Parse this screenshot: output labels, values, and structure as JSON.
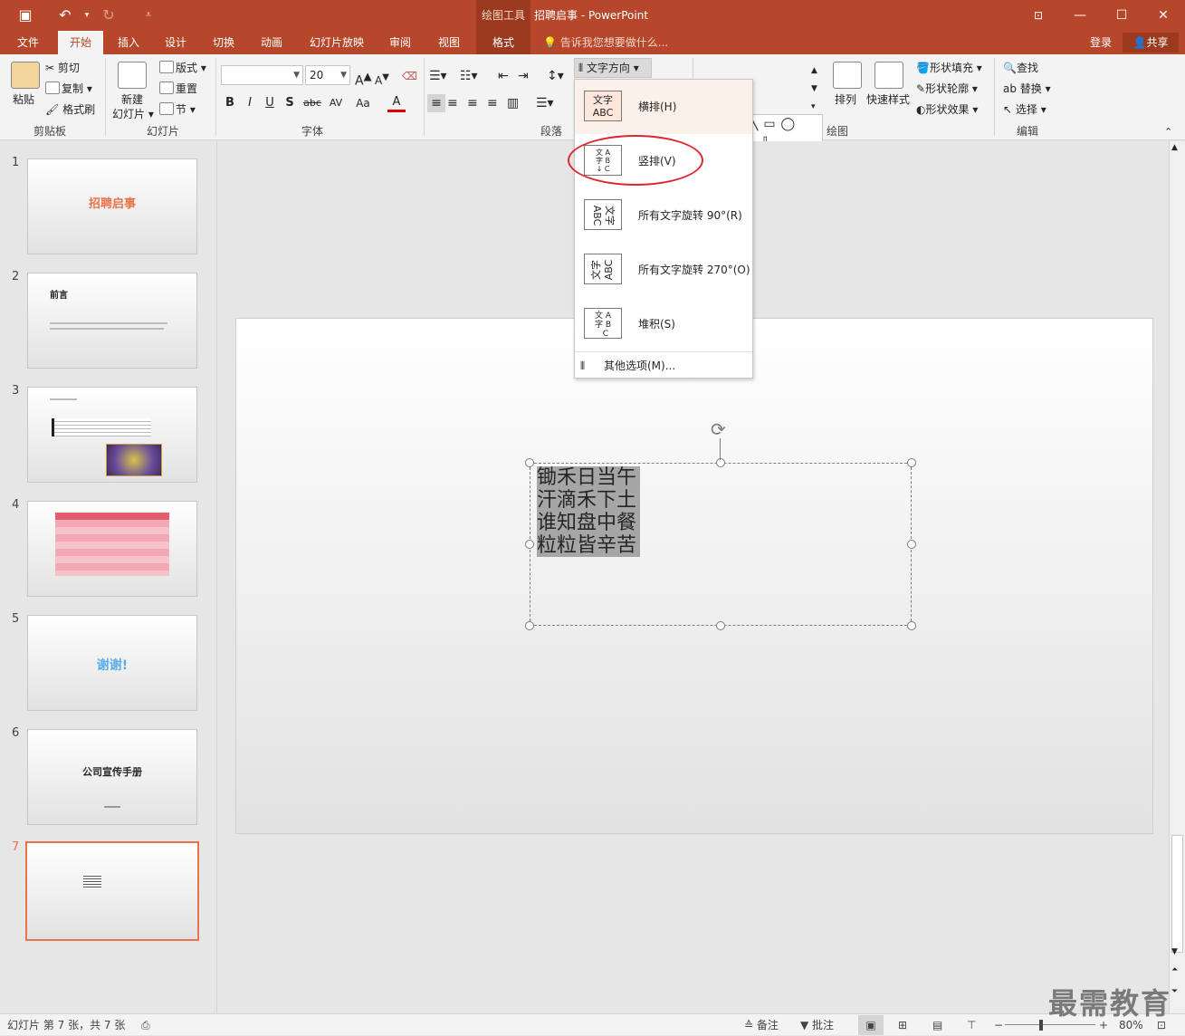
{
  "titlebar": {
    "context_group": "绘图工具",
    "title": "招聘启事 - PowerPoint",
    "icons": [
      "save-icon",
      "undo-icon",
      "redo-icon",
      "customize-qat-icon"
    ],
    "window_buttons": [
      "ribbon-display-icon",
      "minimize-icon",
      "maximize-icon",
      "close-icon"
    ]
  },
  "tabs": {
    "file": "文件",
    "home": "开始",
    "insert": "插入",
    "design": "设计",
    "transitions": "切换",
    "animations": "动画",
    "slideshow": "幻灯片放映",
    "review": "审阅",
    "view": "视图",
    "format": "格式",
    "tellme": "告诉我您想要做什么...",
    "login": "登录",
    "share": "共享"
  },
  "ribbon": {
    "clipboard": {
      "paste": "粘贴",
      "cut": "剪切",
      "copy": "复制",
      "format_painter": "格式刷",
      "label": "剪贴板"
    },
    "slides": {
      "new_slide_line1": "新建",
      "new_slide_line2": "幻灯片",
      "layout": "版式",
      "reset": "重置",
      "section": "节",
      "label": "幻灯片"
    },
    "font": {
      "font_name": "",
      "font_size": "20",
      "bold": "B",
      "italic": "I",
      "underline": "U",
      "shadow": "S",
      "strike": "abc",
      "spacing": "AV",
      "case": "Aa",
      "color": "A",
      "grow": "A",
      "shrink": "A",
      "label": "字体"
    },
    "paragraph": {
      "text_direction": "文字方向",
      "label": "段落"
    },
    "drawing": {
      "arrange": "排列",
      "quick_styles": "快速样式",
      "shape_fill": "形状填充",
      "shape_outline": "形状轮廓",
      "shape_effects": "形状效果",
      "label": "绘图"
    },
    "editing": {
      "find": "查找",
      "replace": "替换",
      "select": "选择",
      "label": "编辑"
    }
  },
  "text_direction_menu": {
    "items": [
      {
        "label": "横排(H)",
        "icon_text": "文字\nABC",
        "icon": "horizontal-text-icon"
      },
      {
        "label": "竖排(V)",
        "icon_text": "文字ABC",
        "icon": "vertical-text-icon"
      },
      {
        "label": "所有文字旋转 90°(R)",
        "icon_text": "文字ABC",
        "icon": "rotate-90-icon"
      },
      {
        "label": "所有文字旋转 270°(O)",
        "icon_text": "文字ABC",
        "icon": "rotate-270-icon"
      },
      {
        "label": "堆积(S)",
        "icon_text": "文字ABC",
        "icon": "stacked-text-icon"
      }
    ],
    "more_options": "其他选项(M)..."
  },
  "slides_panel": [
    {
      "num": "1",
      "title": "招聘启事"
    },
    {
      "num": "2",
      "title": "前言"
    },
    {
      "num": "3",
      "title": ""
    },
    {
      "num": "4",
      "title": ""
    },
    {
      "num": "5",
      "title": "谢谢!"
    },
    {
      "num": "6",
      "title": "公司宣传手册"
    },
    {
      "num": "7",
      "title": ""
    }
  ],
  "slide": {
    "poem_lines": [
      "锄禾日当午",
      "汗滴禾下土",
      "谁知盘中餐",
      "粒粒皆辛苦"
    ]
  },
  "status": {
    "slide_info": "幻灯片 第 7 张，共 7 张",
    "notes": "备注",
    "comments": "批注",
    "zoom": "80%"
  },
  "watermark": "最需教育",
  "colors": {
    "accent": "#b7472a",
    "selected_thumb": "#e8734c",
    "annotation": "#e0242d"
  }
}
